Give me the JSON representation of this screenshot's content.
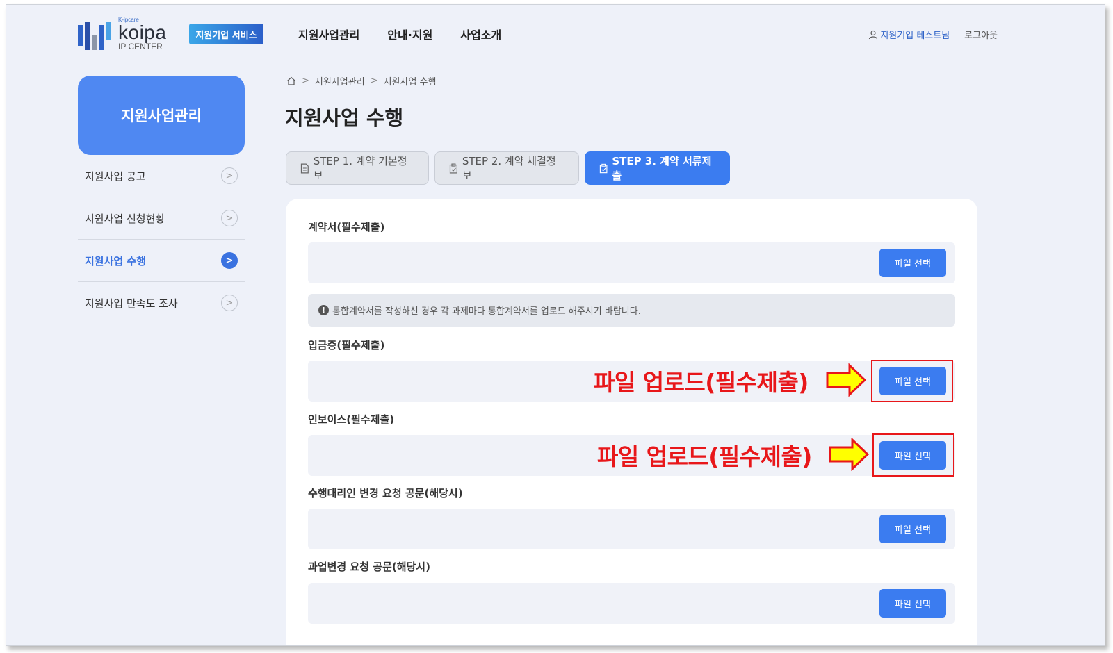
{
  "header": {
    "logo_small": "K-ipcare",
    "logo_main": "koipa",
    "logo_sub": "IP CENTER",
    "service_badge": "지원기업 서비스",
    "nav": [
      "지원사업관리",
      "안내·지원",
      "사업소개"
    ],
    "user_label": "지원기업 테스트님",
    "logout_label": "로그아웃"
  },
  "sidebar": {
    "title": "지원사업관리",
    "items": [
      {
        "label": "지원사업 공고"
      },
      {
        "label": "지원사업 신청현황"
      },
      {
        "label": "지원사업 수행"
      },
      {
        "label": "지원사업 만족도 조사"
      }
    ],
    "active_index": 2
  },
  "breadcrumb": [
    "지원사업관리",
    "지원사업 수행"
  ],
  "page_title": "지원사업 수행",
  "steps": [
    {
      "label": "STEP 1. 계약 기본정보"
    },
    {
      "label": "STEP 2. 계약 체결정보"
    },
    {
      "label": "STEP 3. 계약 서류제출"
    }
  ],
  "active_step": 2,
  "form": {
    "fields": [
      {
        "label": "계약서(필수제출)",
        "button": "파일 선택"
      },
      {
        "label": "입금증(필수제출)",
        "button": "파일 선택"
      },
      {
        "label": "인보이스(필수제출)",
        "button": "파일 선택"
      },
      {
        "label": "수행대리인 변경 요청 공문(해당시)",
        "button": "파일 선택"
      },
      {
        "label": "과업변경 요청 공문(해당시)",
        "button": "파일 선택"
      }
    ],
    "notice": "통합계약서를 작성하신 경우 각 과제마다 통합계약서를 업로드 해주시기 바랍니다."
  },
  "annotations": [
    {
      "text": "파일 업로드(필수제출)"
    },
    {
      "text": "파일 업로드(필수제출)"
    }
  ],
  "colors": {
    "primary": "#3b7cf0",
    "sidebar_title_bg": "#4f88f2",
    "annotation": "#e8171a",
    "arrow_fill": "#ffff00",
    "page_bg": "#eef1f9"
  }
}
